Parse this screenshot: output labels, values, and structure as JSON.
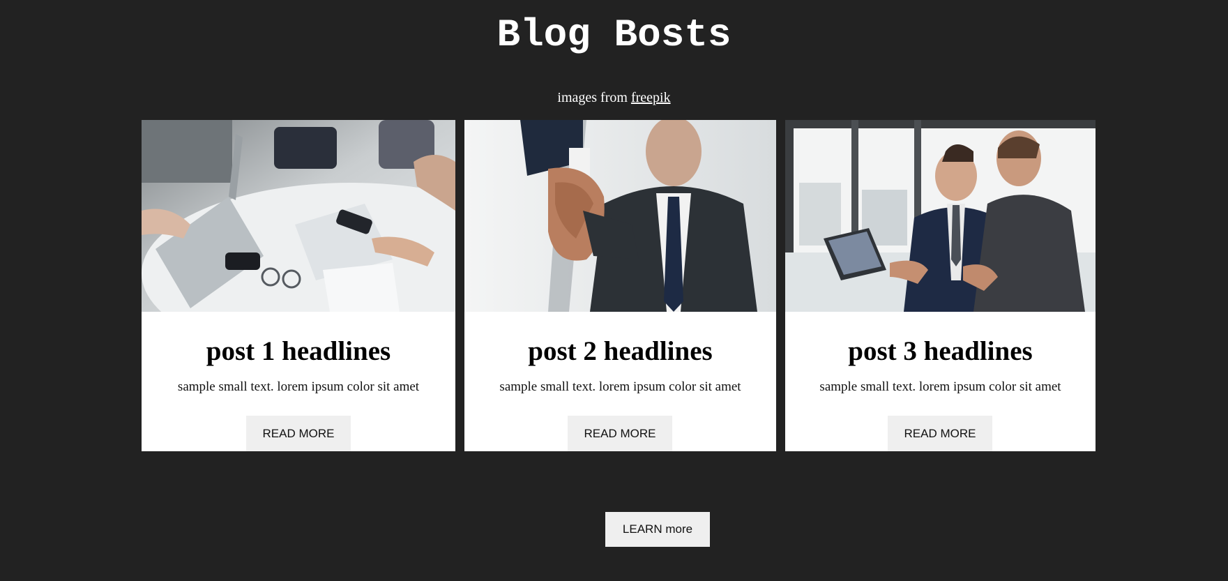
{
  "page": {
    "title": "Blog Bosts",
    "credit_prefix": "images from ",
    "credit_link": "freepik"
  },
  "posts": [
    {
      "headline": "post 1 headlines",
      "text": "sample small text. lorem ipsum color sit amet",
      "button_label": "READ MORE",
      "image_subject": "team-meeting-table-photo"
    },
    {
      "headline": "post 2 headlines",
      "text": "sample small text. lorem ipsum color sit amet",
      "button_label": "READ MORE",
      "image_subject": "business-handshake-photo"
    },
    {
      "headline": "post 3 headlines",
      "text": "sample small text. lorem ipsum color sit amet",
      "button_label": "READ MORE",
      "image_subject": "businessmen-laptop-photo"
    }
  ],
  "footer": {
    "learn_more_label": "LEARN more"
  },
  "colors": {
    "background": "#222222",
    "card": "#ffffff",
    "button": "#efefef"
  }
}
